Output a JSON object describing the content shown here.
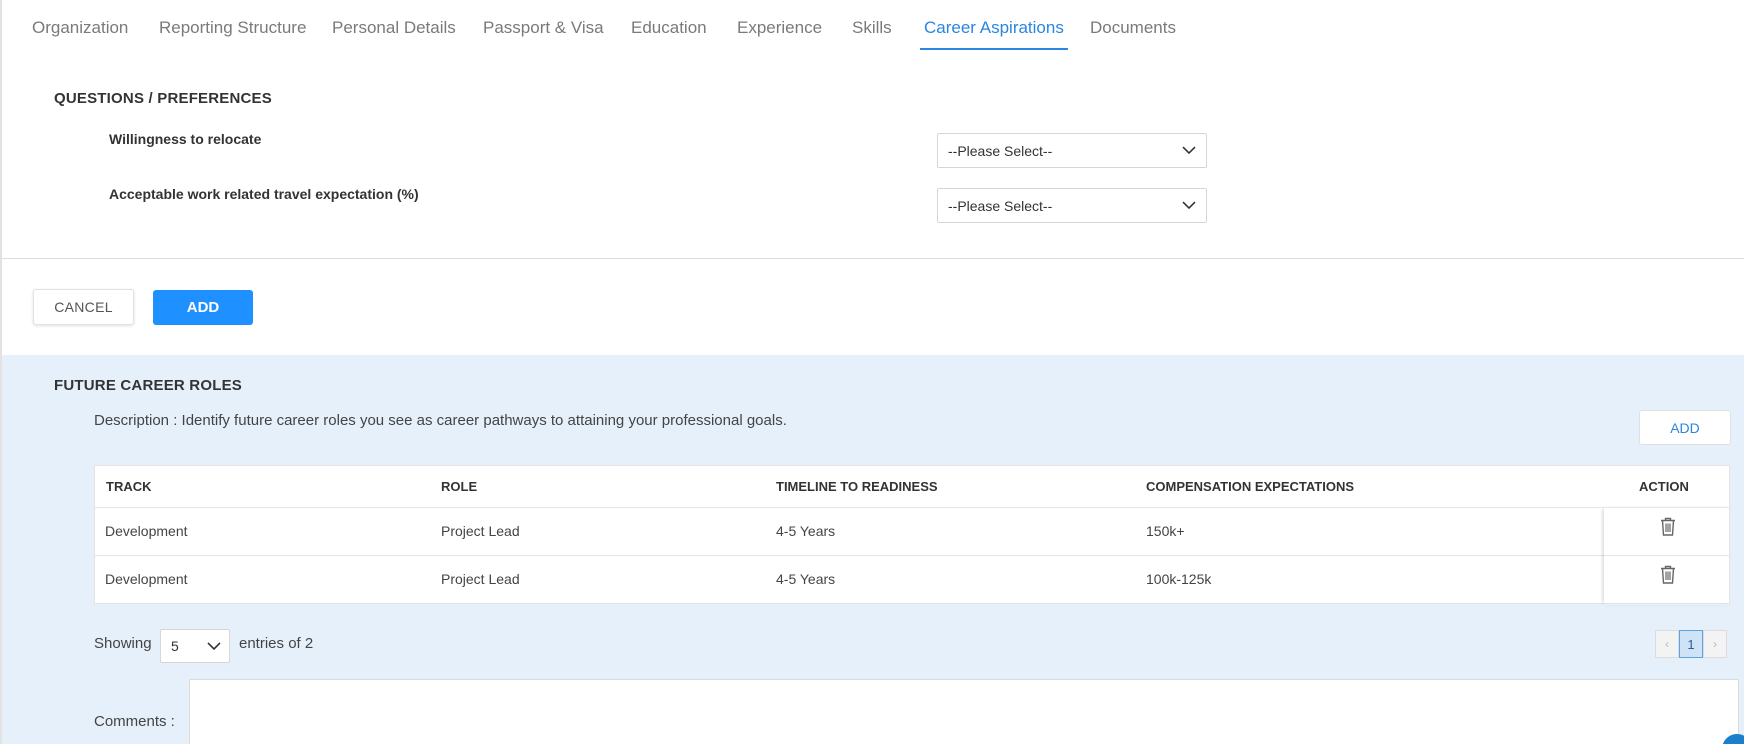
{
  "tabs": [
    {
      "label": "Organization"
    },
    {
      "label": "Reporting Structure"
    },
    {
      "label": "Personal Details"
    },
    {
      "label": "Passport & Visa"
    },
    {
      "label": "Education"
    },
    {
      "label": "Experience"
    },
    {
      "label": "Skills"
    },
    {
      "label": "Career Aspirations"
    },
    {
      "label": "Documents"
    }
  ],
  "questions": {
    "title": "QUESTIONS / PREFERENCES",
    "items": [
      {
        "label": "Willingness to relocate",
        "value": "--Please Select--"
      },
      {
        "label": "Acceptable work related travel expectation (%)",
        "value": "--Please Select--"
      }
    ],
    "cancel_label": "CANCEL",
    "add_label": "ADD"
  },
  "future_roles": {
    "title": "FUTURE CAREER ROLES",
    "description": "Description : Identify future career roles you see as career pathways to attaining your professional goals.",
    "add_label": "ADD",
    "columns": [
      "TRACK",
      "ROLE",
      "TIMELINE TO READINESS",
      "COMPENSATION EXPECTATIONS",
      "ACTION"
    ],
    "rows": [
      [
        "Development",
        "Project Lead",
        "4-5 Years",
        "150k+"
      ],
      [
        "Development",
        "Project Lead",
        "4-5 Years",
        "100k-125k"
      ]
    ],
    "action_icon": "trash-icon",
    "showing_label": "Showing",
    "page_size": "5",
    "entries_label": "entries of 2",
    "pager": {
      "prev": "‹",
      "current": "1",
      "next": "›"
    },
    "comments_label": "Comments :"
  },
  "colors": {
    "accent": "#2b86e0",
    "primary_button": "#1e90ff",
    "section_bg": "#e6f0fb"
  }
}
